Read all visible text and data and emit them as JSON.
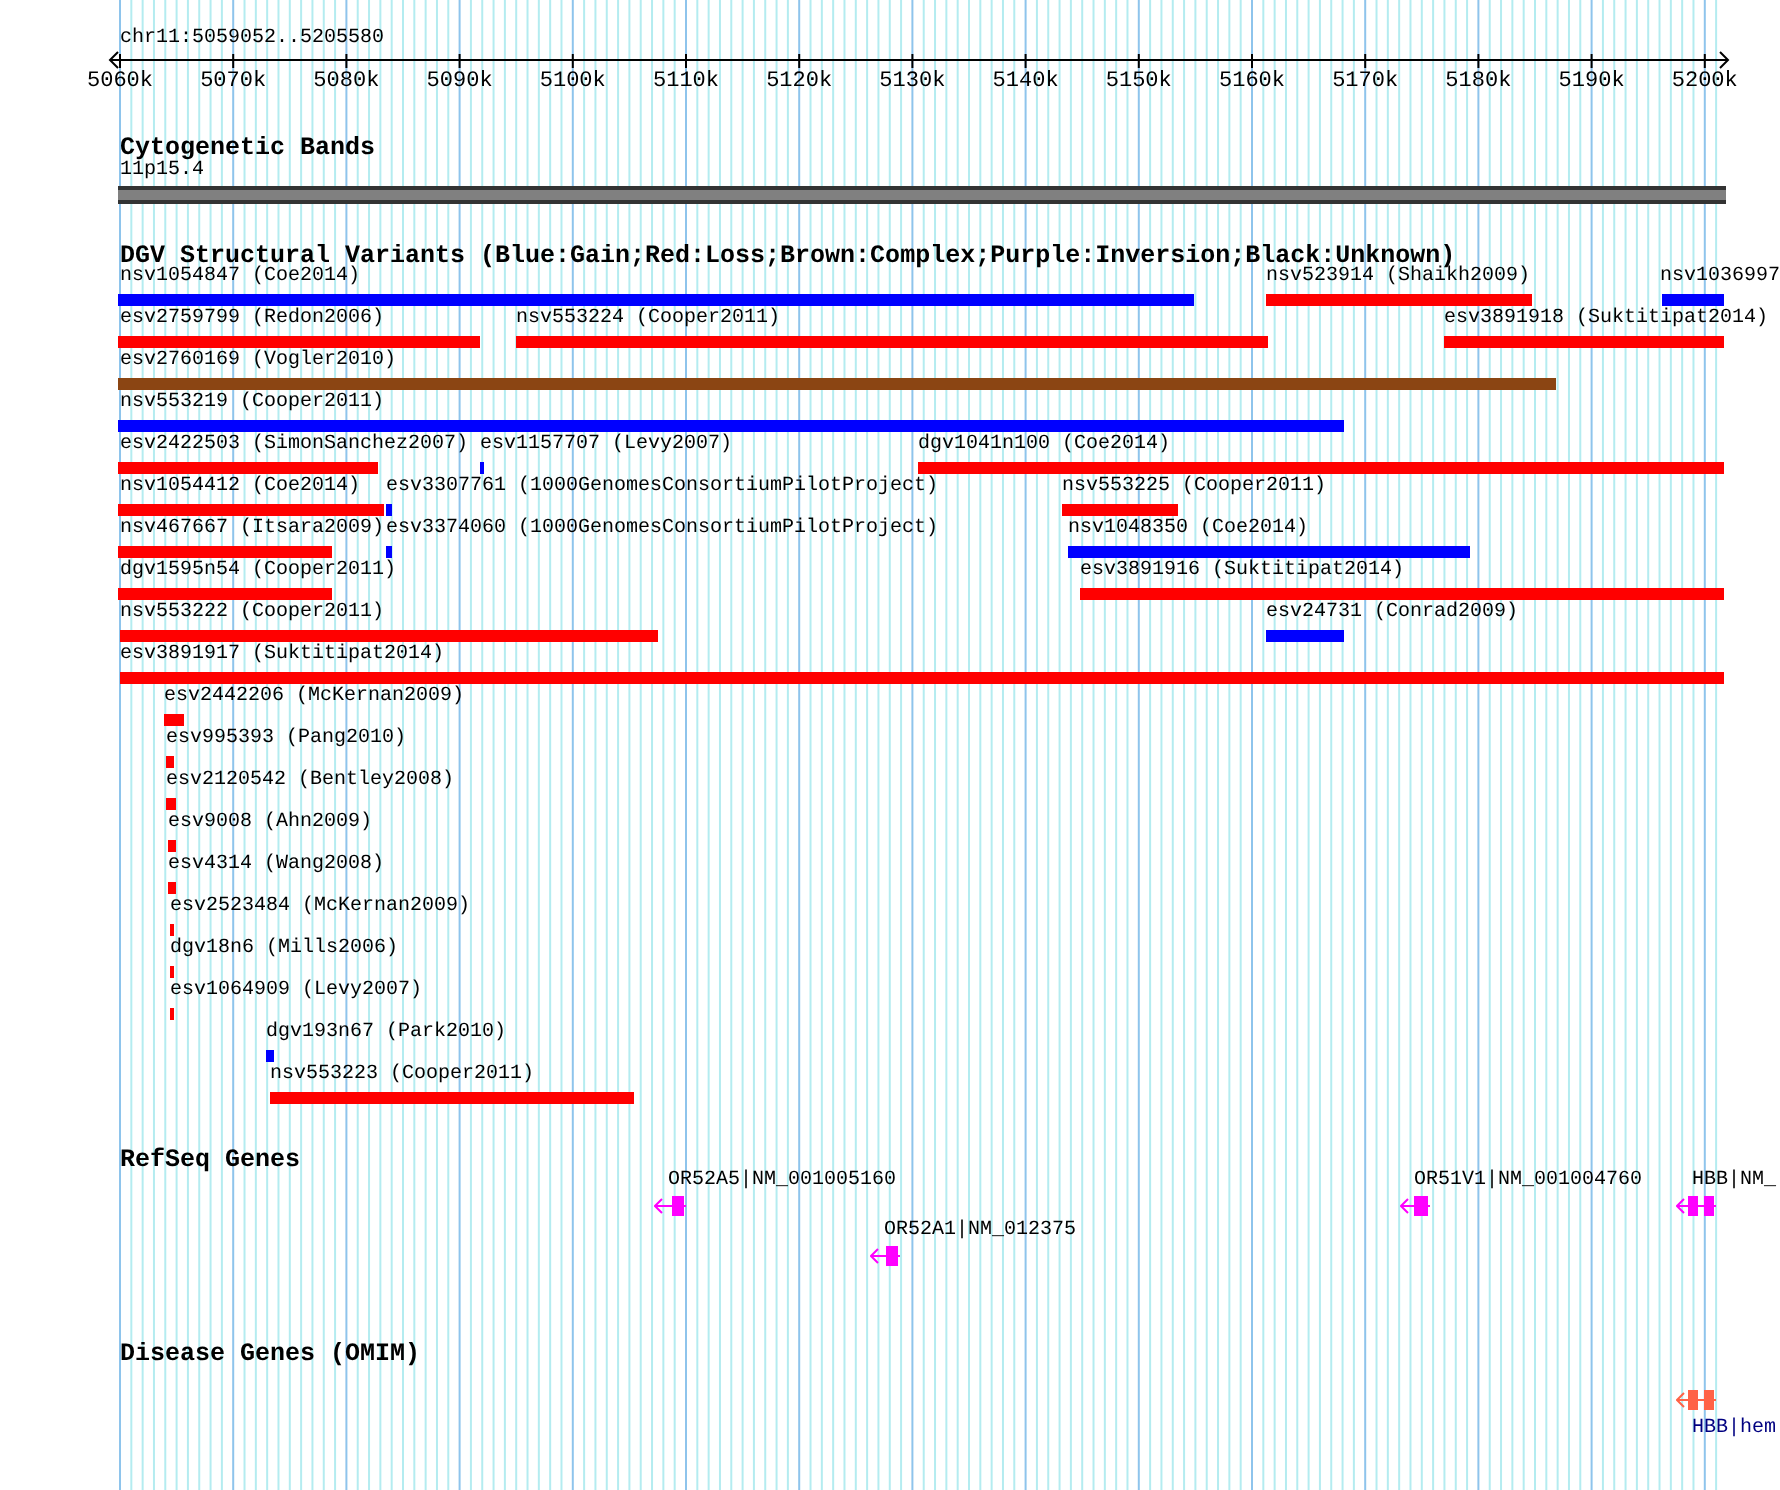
{
  "position": "chr11:5059052..5205580",
  "ruler": {
    "ticks": [
      "5060k",
      "5070k",
      "5080k",
      "5090k",
      "5100k",
      "5110k",
      "5120k",
      "5130k",
      "5140k",
      "5150k",
      "5160k",
      "5170k",
      "5180k",
      "5190k",
      "5200k"
    ]
  },
  "cytoband": {
    "title": "Cytogenetic Bands",
    "band": "11p15.4"
  },
  "variants": {
    "title": "DGV Structural Variants (Blue:Gain;Red:Loss;Brown:Complex;Purple:Inversion;Black:Unknown)",
    "rows": [
      {
        "features": [
          {
            "name": "nsv1054847 (Coe2014)",
            "color": "#0000ff"
          },
          {
            "name": "nsv523914 (Shaikh2009)",
            "color": "#ff0000"
          },
          {
            "name": "nsv1036997",
            "color": "#0000ff"
          }
        ]
      },
      {
        "features": [
          {
            "name": "esv2759799 (Redon2006)",
            "color": "#ff0000"
          },
          {
            "name": "nsv553224 (Cooper2011)",
            "color": "#ff0000"
          },
          {
            "name": "esv3891918 (Suktitipat2014)",
            "color": "#ff0000"
          }
        ]
      },
      {
        "features": [
          {
            "name": "esv2760169 (Vogler2010)",
            "color": "#8b4513"
          }
        ]
      },
      {
        "features": [
          {
            "name": "nsv553219 (Cooper2011)",
            "color": "#0000ff"
          }
        ]
      },
      {
        "features": [
          {
            "name": "esv2422503 (SimonSanchez2007)",
            "color": "#ff0000"
          },
          {
            "name": "esv1157707 (Levy2007)",
            "color": "#0000ff"
          },
          {
            "name": "dgv1041n100 (Coe2014)",
            "color": "#ff0000"
          }
        ]
      },
      {
        "features": [
          {
            "name": "nsv1054412 (Coe2014)",
            "color": "#ff0000"
          },
          {
            "name": "esv3307761 (1000GenomesConsortiumPilotProject)",
            "color": "#0000ff"
          },
          {
            "name": "nsv553225 (Cooper2011)",
            "color": "#ff0000"
          }
        ]
      },
      {
        "features": [
          {
            "name": "nsv467667 (Itsara2009)",
            "color": "#ff0000"
          },
          {
            "name": "esv3374060 (1000GenomesConsortiumPilotProject)",
            "color": "#0000ff"
          },
          {
            "name": "nsv1048350 (Coe2014)",
            "color": "#0000ff"
          }
        ]
      },
      {
        "features": [
          {
            "name": "dgv1595n54 (Cooper2011)",
            "color": "#ff0000"
          },
          {
            "name": "esv3891916 (Suktitipat2014)",
            "color": "#ff0000"
          }
        ]
      },
      {
        "features": [
          {
            "name": "nsv553222 (Cooper2011)",
            "color": "#ff0000"
          },
          {
            "name": "esv24731 (Conrad2009)",
            "color": "#0000ff"
          }
        ]
      },
      {
        "features": [
          {
            "name": "esv3891917 (Suktitipat2014)",
            "color": "#ff0000"
          }
        ]
      },
      {
        "features": [
          {
            "name": "esv2442206 (McKernan2009)",
            "color": "#ff0000"
          }
        ]
      },
      {
        "features": [
          {
            "name": "esv995393 (Pang2010)",
            "color": "#ff0000"
          }
        ]
      },
      {
        "features": [
          {
            "name": "esv2120542 (Bentley2008)",
            "color": "#ff0000"
          }
        ]
      },
      {
        "features": [
          {
            "name": "esv9008 (Ahn2009)",
            "color": "#ff0000"
          }
        ]
      },
      {
        "features": [
          {
            "name": "esv4314 (Wang2008)",
            "color": "#ff0000"
          }
        ]
      },
      {
        "features": [
          {
            "name": "esv2523484 (McKernan2009)",
            "color": "#ff0000"
          }
        ]
      },
      {
        "features": [
          {
            "name": "dgv18n6 (Mills2006)",
            "color": "#ff0000"
          }
        ]
      },
      {
        "features": [
          {
            "name": "esv1064909 (Levy2007)",
            "color": "#ff0000"
          }
        ]
      },
      {
        "features": [
          {
            "name": "dgv193n67 (Park2010)",
            "color": "#0000ff"
          }
        ]
      },
      {
        "features": [
          {
            "name": "nsv553223 (Cooper2011)",
            "color": "#ff0000"
          }
        ]
      }
    ]
  },
  "refseq": {
    "title": "RefSeq Genes",
    "genes": [
      {
        "label": "OR52A5|NM_001005160"
      },
      {
        "label": "OR52A1|NM_012375"
      },
      {
        "label": "OR51V1|NM_001004760"
      },
      {
        "label": "HBB|NM_"
      }
    ]
  },
  "omim": {
    "title": "Disease Genes (OMIM)",
    "genes": [
      {
        "label": "HBB|hem"
      }
    ]
  }
}
